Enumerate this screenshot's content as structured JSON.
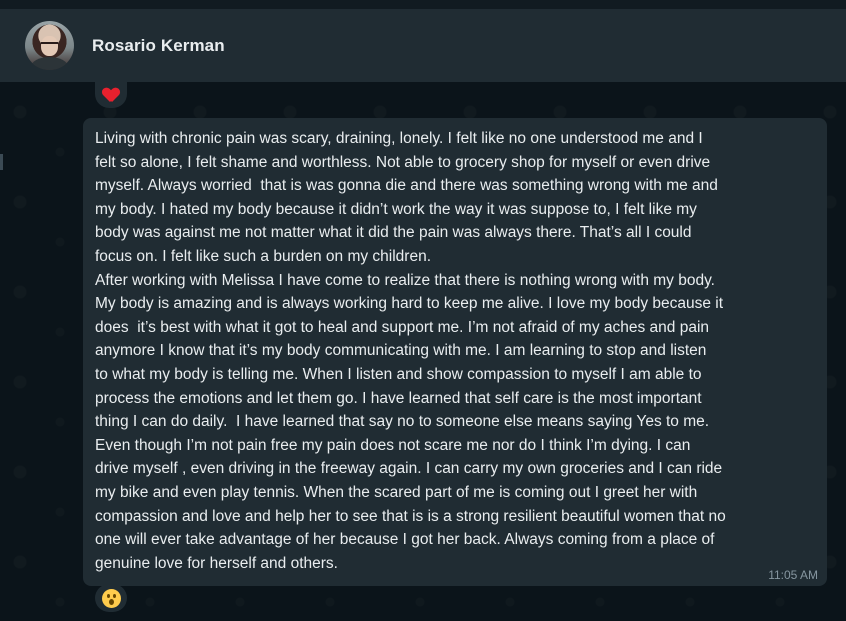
{
  "header": {
    "contact_name": "Rosario Kerman"
  },
  "reactions": {
    "top": "heart",
    "bottom": "surprised-face"
  },
  "message": {
    "text": "Living with chronic pain was scary, draining, lonely. I felt like no one understood me and I\nfelt so alone, I felt shame and worthless. Not able to grocery shop for myself or even drive\nmyself. Always worried  that is was gonna die and there was something wrong with me and\nmy body. I hated my body because it didn’t work the way it was suppose to, I felt like my\nbody was against me not matter what it did the pain was always there. That’s all I could\nfocus on. I felt like such a burden on my children.\nAfter working with Melissa I have come to realize that there is nothing wrong with my body.\nMy body is amazing and is always working hard to keep me alive. I love my body because it\ndoes  it’s best with what it got to heal and support me. I’m not afraid of my aches and pain\nanymore I know that it’s my body communicating with me. I am learning to stop and listen\nto what my body is telling me. When I listen and show compassion to myself I am able to\nprocess the emotions and let them go. I have learned that self care is the most important\nthing I can do daily.  I have learned that say no to someone else means saying Yes to me.\nEven though I’m not pain free my pain does not scare me nor do I think I’m dying. I can\ndrive myself , even driving in the freeway again. I can carry my own groceries and I can ride\nmy bike and even play tennis. When the scared part of me is coming out I greet her with\ncompassion and love and help her to see that is is a strong resilient beautiful women that no\none will ever take advantage of her because I got her back. Always coming from a place of\ngenuine love for herself and others.",
    "time": "11:05 AM"
  },
  "colors": {
    "background": "#0b141a",
    "header": "#202c33",
    "bubble": "#202c33",
    "text": "#e9edef",
    "meta": "#8696a0"
  }
}
